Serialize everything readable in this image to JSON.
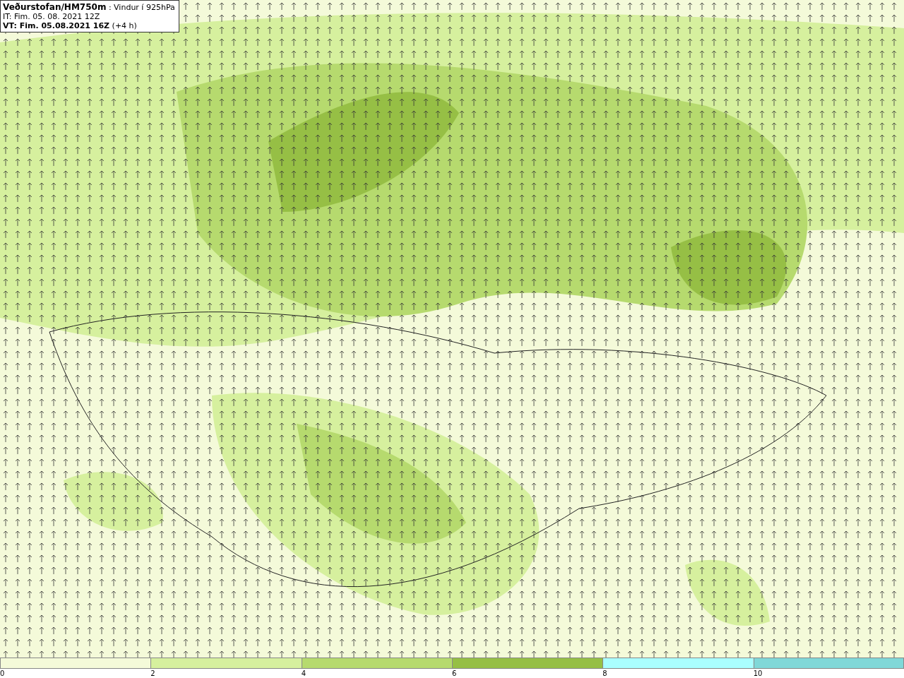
{
  "header": {
    "title": "**Veðurstofan/HM750m** : Vindur í 925hPa",
    "initial_time": "IT: Fim. 05. 08. 2021 12Z",
    "valid_time": "**VT: Fim. 05.08.2021 16Z** (+4 h)"
  },
  "legend": [
    {
      "label": "0",
      "color": "#f4fad9"
    },
    {
      "label": "2",
      "color": "#d6f09e"
    },
    {
      "label": "4",
      "color": "#b6da6e"
    },
    {
      "label": "6",
      "color": "#96bf45"
    },
    {
      "label": "8",
      "color": "#aaffff"
    },
    {
      "label": "10",
      "color": "#80d8d8"
    }
  ]
}
